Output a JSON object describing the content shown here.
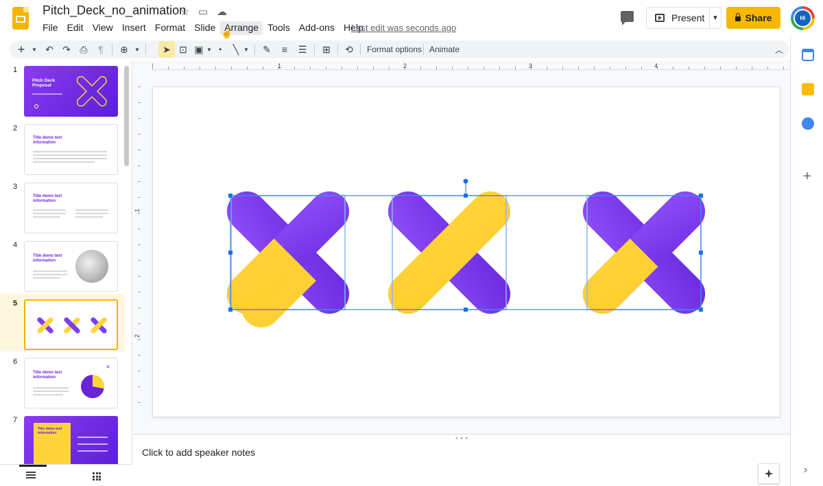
{
  "header": {
    "doc_title": "Pitch_Deck_no_animation",
    "menus": [
      "File",
      "Edit",
      "View",
      "Insert",
      "Format",
      "Slide",
      "Arrange",
      "Tools",
      "Add-ons",
      "Help"
    ],
    "active_menu": "Arrange",
    "last_edit": "Last edit was seconds ago",
    "present_label": "Present",
    "share_label": "Share",
    "avatar_text": "Hi"
  },
  "toolbar": {
    "format_options": "Format options",
    "animate": "Animate"
  },
  "filmstrip": {
    "slides": [
      {
        "num": "1",
        "title": "Pitch Deck Proposal"
      },
      {
        "num": "2",
        "title": "Title demo text information"
      },
      {
        "num": "3",
        "title": "Title demo text information"
      },
      {
        "num": "4",
        "title": "Title demo text information"
      },
      {
        "num": "5",
        "title": ""
      },
      {
        "num": "6",
        "title": "Title demo text information"
      },
      {
        "num": "7",
        "title": "Title demo text information"
      }
    ],
    "selected": 5
  },
  "ruler": {
    "h_labels": [
      "1",
      "2",
      "3",
      "4"
    ],
    "v_labels": [
      "1",
      "2"
    ]
  },
  "notes": {
    "placeholder": "Click to add speaker notes"
  },
  "colors": {
    "purple": "#7b3ff2",
    "purple_dark": "#6226d6",
    "yellow": "#ffd43b",
    "share": "#f9b800",
    "selection": "#1a73e8"
  },
  "icons": [
    "add-icon",
    "undo-icon",
    "redo-icon",
    "print-icon",
    "paint-format-icon",
    "zoom-icon",
    "select-icon",
    "textbox-icon",
    "image-icon",
    "shape-icon",
    "line-icon",
    "pen-icon",
    "border-weight-icon",
    "border-dash-icon",
    "comment-add-icon",
    "replace-image-icon",
    "collapse-icon"
  ]
}
